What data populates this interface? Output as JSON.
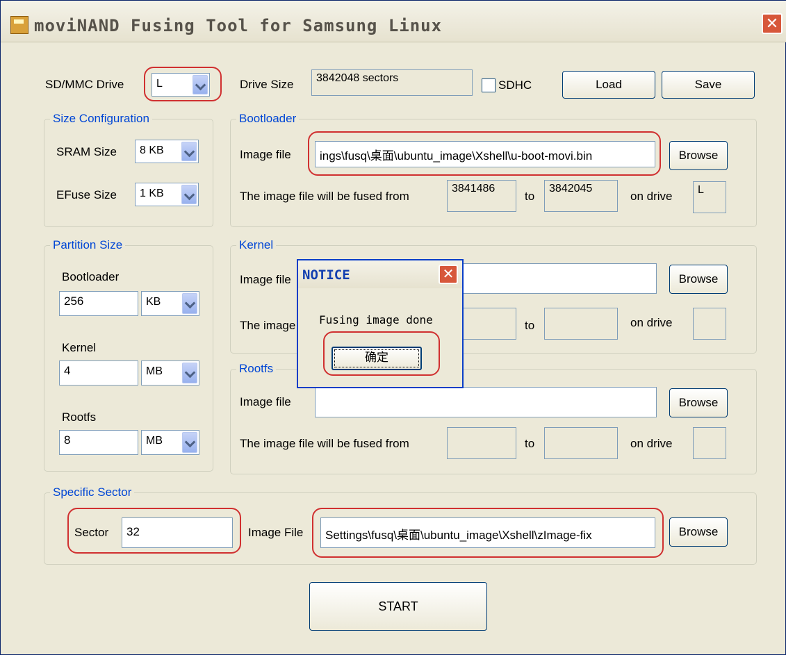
{
  "window": {
    "title": "moviNAND Fusing Tool for Samsung Linux",
    "close_glyph": "✕"
  },
  "top": {
    "drive_label": "SD/MMC Drive",
    "drive_value": "L",
    "drive_size_label": "Drive Size",
    "drive_size_value": "3842048 sectors",
    "sdhc_label": "SDHC",
    "sdhc_checked": false,
    "load_label": "Load",
    "save_label": "Save"
  },
  "size_config": {
    "title": "Size Configuration",
    "sram_label": "SRAM Size",
    "sram_value": "8 KB",
    "efuse_label": "EFuse Size",
    "efuse_value": "1 KB"
  },
  "partition": {
    "title": "Partition Size",
    "bootloader_label": "Bootloader",
    "bootloader_value": "256",
    "bootloader_unit": "KB",
    "kernel_label": "Kernel",
    "kernel_value": "4",
    "kernel_unit": "MB",
    "rootfs_label": "Rootfs",
    "rootfs_value": "8",
    "rootfs_unit": "MB"
  },
  "bootloader": {
    "title": "Bootloader",
    "image_label": "Image file",
    "image_value": "ings\\fusq\\桌面\\ubuntu_image\\Xshell\\u-boot-movi.bin",
    "browse_label": "Browse",
    "fused_from_label": "The image file will be fused from",
    "from_value": "3841486",
    "to_label": "to",
    "to_value": "3842045",
    "on_drive_label": "on drive",
    "drive_value": "L"
  },
  "kernel": {
    "title": "Kernel",
    "image_label": "Image file",
    "image_value": "",
    "browse_label": "Browse",
    "fused_from_label": "The image file will be fused from",
    "to_label": "to",
    "on_drive_label": "on drive"
  },
  "rootfs": {
    "title": "Rootfs",
    "image_label": "Image file",
    "image_value": "",
    "browse_label": "Browse",
    "fused_from_label": "The image file will be fused from",
    "to_label": "to",
    "on_drive_label": "on drive"
  },
  "specific": {
    "title": "Specific Sector",
    "sector_label": "Sector",
    "sector_value": "32",
    "image_label": "Image File",
    "image_value": "Settings\\fusq\\桌面\\ubuntu_image\\Xshell\\zImage-fix",
    "browse_label": "Browse"
  },
  "start_label": "START",
  "dialog": {
    "title": "NOTICE",
    "message": "Fusing image done",
    "ok_label": "确定",
    "close_glyph": "✕"
  },
  "colors": {
    "window_bg": "#ece9d8",
    "group_title": "#0046d5",
    "highlight": "#d03030"
  }
}
